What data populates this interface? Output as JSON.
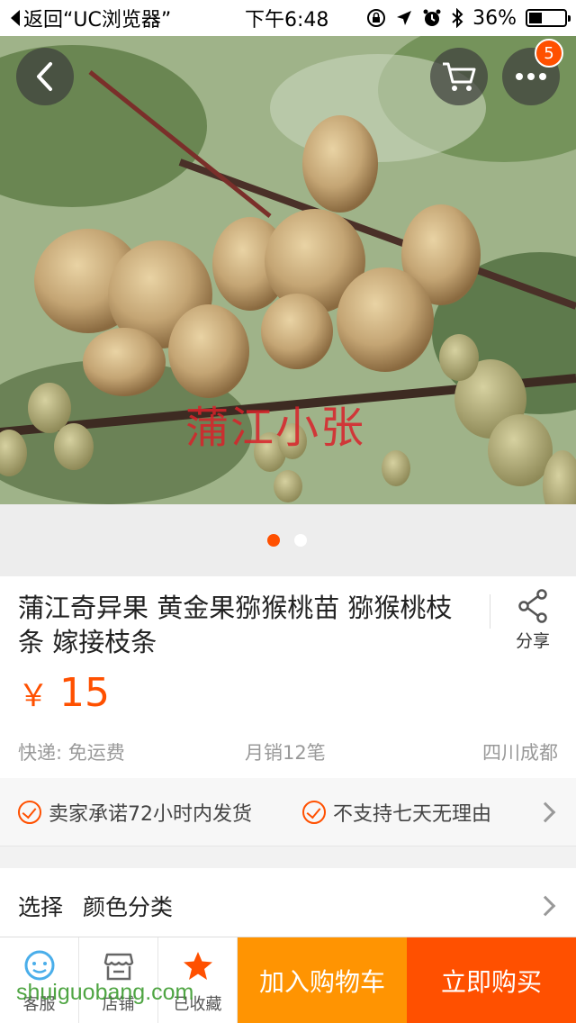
{
  "status_bar": {
    "back_label": "返回“UC浏览器”",
    "time": "下午6:48",
    "battery": "36%",
    "battery_level": 0.36
  },
  "gallery": {
    "watermark": "蒲江小张",
    "cart_badge": "5",
    "page_count": 2,
    "active_page": 1
  },
  "product": {
    "title": "蒲江奇异果 黄金果猕猴桃苗 猕猴桃枝条 嫁接枝条",
    "share_label": "分享",
    "currency": "￥",
    "price": "15",
    "shipping": "快递: 免运费",
    "monthly_sales": "月销12笔",
    "location": "四川成都"
  },
  "promises": {
    "first": "卖家承诺72小时内发货",
    "second": "不支持七天无理由"
  },
  "select": {
    "label": "选择",
    "value": "颜色分类"
  },
  "bottom_bar": {
    "service": "客服",
    "shop": "店铺",
    "favorite": "已收藏",
    "add_to_cart": "加入购物车",
    "buy_now": "立即购买"
  },
  "site_watermark": "shuiguobang.com",
  "colors": {
    "accent": "#ff5000",
    "cart_button": "#ff9402",
    "watermark_red": "#d9222a"
  }
}
